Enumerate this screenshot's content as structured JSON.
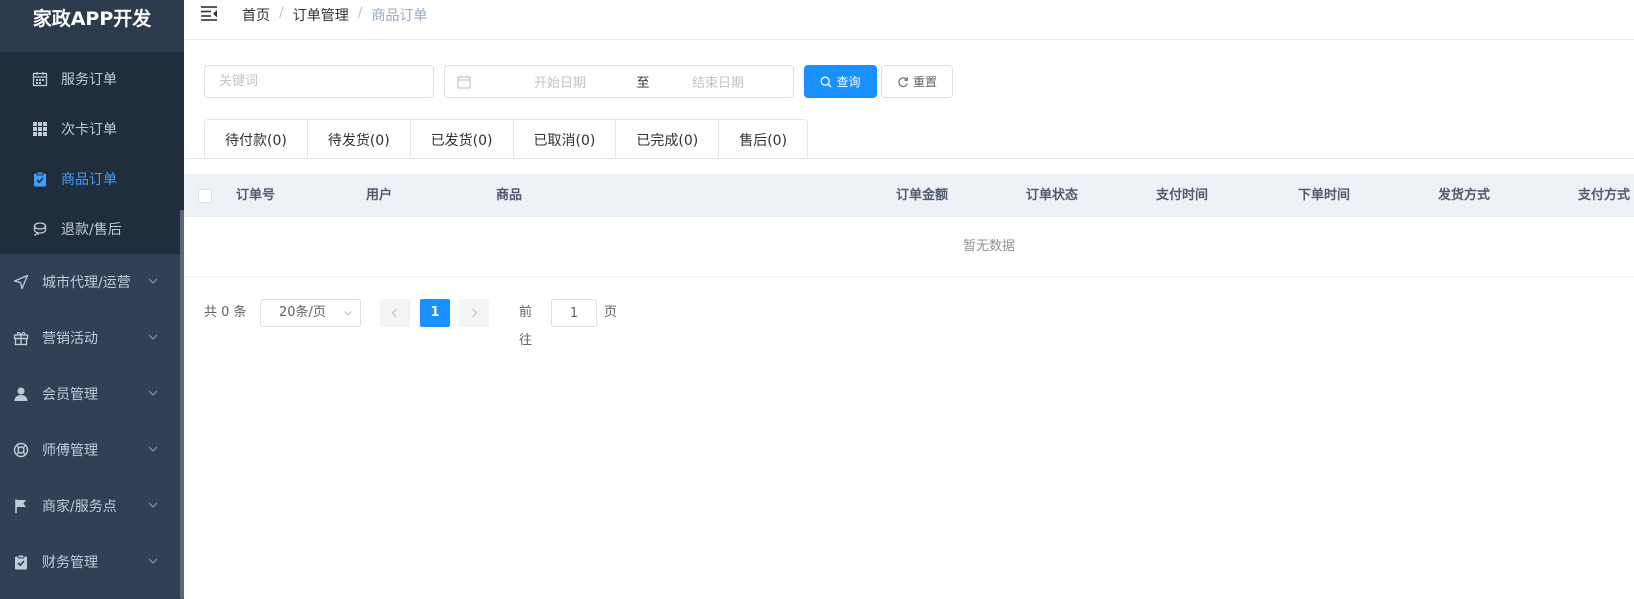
{
  "app": {
    "title": "家政APP开发"
  },
  "colors": {
    "sidebar_bg": "#304156",
    "submenu_bg": "#1f2d3d",
    "accent": "#1890ff",
    "active_menu": "#409eff"
  },
  "sidebar": {
    "submenu": [
      {
        "label": "服务订单",
        "icon": "calendar-icon"
      },
      {
        "label": "次卡订单",
        "icon": "grid-icon"
      },
      {
        "label": "商品订单",
        "icon": "clipboard-check-icon",
        "active": true
      },
      {
        "label": "退款/售后",
        "icon": "refund-icon"
      }
    ],
    "menus": [
      {
        "label": "城市代理/运营",
        "icon": "navigation-icon"
      },
      {
        "label": "营销活动",
        "icon": "gift-icon"
      },
      {
        "label": "会员管理",
        "icon": "user-icon"
      },
      {
        "label": "师傅管理",
        "icon": "lifebuoy-icon"
      },
      {
        "label": "商家/服务点",
        "icon": "flag-icon"
      },
      {
        "label": "财务管理",
        "icon": "clipboard-icon"
      }
    ]
  },
  "header": {
    "breadcrumb": [
      "首页",
      "订单管理",
      "商品订单"
    ],
    "separator": "/"
  },
  "search": {
    "keyword_placeholder": "关键词",
    "keyword_value": "",
    "date_start_placeholder": "开始日期",
    "date_to": "至",
    "date_end_placeholder": "结束日期",
    "query_label": "查询",
    "reset_label": "重置"
  },
  "tabs": [
    "待付款(0)",
    "待发货(0)",
    "已发货(0)",
    "已取消(0)",
    "已完成(0)",
    "售后(0)"
  ],
  "table": {
    "columns": [
      "订单号",
      "用户",
      "商品",
      "订单金额",
      "订单状态",
      "支付时间",
      "下单时间",
      "发货方式",
      "支付方式"
    ],
    "rows": [],
    "empty_text": "暂无数据"
  },
  "pagination": {
    "total_text": "共 0 条",
    "page_size": "20条/页",
    "current_page": "1",
    "goto_prefix": "前往",
    "goto_value": "1",
    "goto_suffix": "页"
  }
}
